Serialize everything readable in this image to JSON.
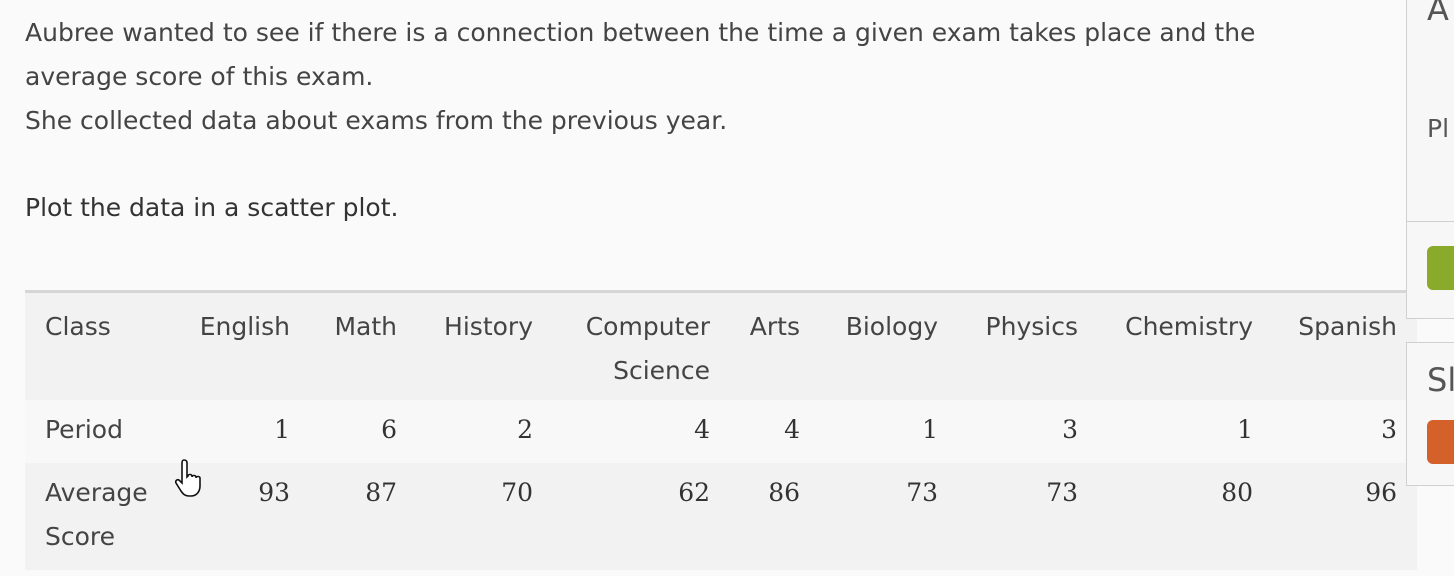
{
  "prompt": {
    "line1": "Aubree wanted to see if there is a connection between the time a given exam takes place and the",
    "line2": "average score of this exam.",
    "line3": "She collected data about exams from the previous year."
  },
  "instruction": "Plot the data in a scatter plot.",
  "table": {
    "header_label": "Class",
    "classes": [
      "English",
      "Math",
      "History",
      "Computer Science",
      "Arts",
      "Biology",
      "Physics",
      "Chemistry",
      "Spanish"
    ],
    "period_label": "Period",
    "periods": [
      "1",
      "6",
      "2",
      "4",
      "4",
      "1",
      "3",
      "1",
      "3"
    ],
    "score_label": "Average Score",
    "scores": [
      "93",
      "87",
      "70",
      "62",
      "86",
      "73",
      "73",
      "80",
      "96"
    ]
  },
  "side_panel": {
    "title_fragment": "A",
    "text_fragment": "Pl",
    "second_title_fragment": "Sl",
    "colors": {
      "green_button": "#8aaa2c",
      "orange_button": "#d4612a"
    }
  },
  "cursor": "hand-pointer-icon"
}
